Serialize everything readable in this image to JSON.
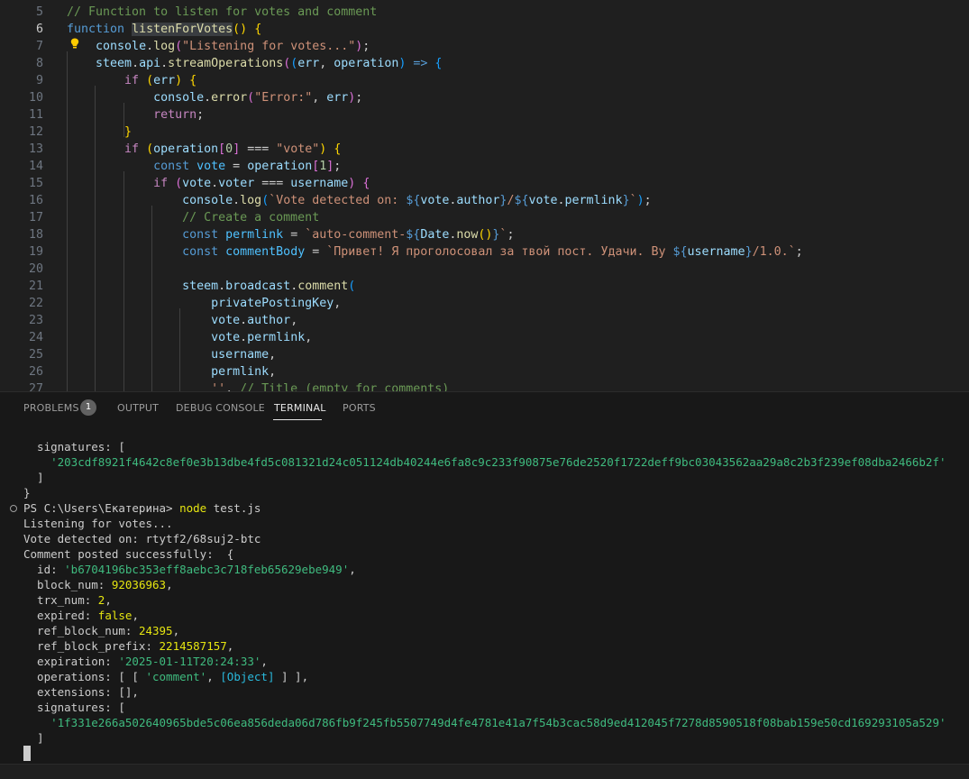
{
  "editor": {
    "lines": [
      {
        "n": "5",
        "tokens": [
          {
            "t": "// Function to listen for votes and comment",
            "c": "com"
          }
        ]
      },
      {
        "n": "6",
        "tokens": [
          {
            "t": "function ",
            "c": "kw"
          },
          {
            "t": "listenForVotes",
            "c": "fn",
            "hl": true
          },
          {
            "t": "(",
            "c": "p1"
          },
          {
            "t": ")",
            "c": "p1"
          },
          {
            "t": " ",
            "c": ""
          },
          {
            "t": "{",
            "c": "p1"
          }
        ]
      },
      {
        "n": "7",
        "tokens": [
          {
            "t": "    ",
            "c": ""
          },
          {
            "t": "console",
            "c": "var"
          },
          {
            "t": ".",
            "c": ""
          },
          {
            "t": "log",
            "c": "fn"
          },
          {
            "t": "(",
            "c": "p2"
          },
          {
            "t": "\"Listening for votes...\"",
            "c": "str"
          },
          {
            "t": ")",
            "c": "p2"
          },
          {
            "t": ";",
            "c": ""
          }
        ]
      },
      {
        "n": "8",
        "tokens": [
          {
            "t": "    ",
            "c": ""
          },
          {
            "t": "steem",
            "c": "var"
          },
          {
            "t": ".",
            "c": ""
          },
          {
            "t": "api",
            "c": "var"
          },
          {
            "t": ".",
            "c": ""
          },
          {
            "t": "streamOperations",
            "c": "fn"
          },
          {
            "t": "(",
            "c": "p2"
          },
          {
            "t": "(",
            "c": "p3"
          },
          {
            "t": "err",
            "c": "var"
          },
          {
            "t": ", ",
            "c": ""
          },
          {
            "t": "operation",
            "c": "var"
          },
          {
            "t": ")",
            "c": "p3"
          },
          {
            "t": " => ",
            "c": "kw"
          },
          {
            "t": "{",
            "c": "p3"
          }
        ]
      },
      {
        "n": "9",
        "tokens": [
          {
            "t": "        ",
            "c": ""
          },
          {
            "t": "if",
            "c": "ctl"
          },
          {
            "t": " ",
            "c": ""
          },
          {
            "t": "(",
            "c": "p1"
          },
          {
            "t": "err",
            "c": "var"
          },
          {
            "t": ")",
            "c": "p1"
          },
          {
            "t": " ",
            "c": ""
          },
          {
            "t": "{",
            "c": "p1"
          }
        ]
      },
      {
        "n": "10",
        "tokens": [
          {
            "t": "            ",
            "c": ""
          },
          {
            "t": "console",
            "c": "var"
          },
          {
            "t": ".",
            "c": ""
          },
          {
            "t": "error",
            "c": "fn"
          },
          {
            "t": "(",
            "c": "p2"
          },
          {
            "t": "\"Error:\"",
            "c": "str"
          },
          {
            "t": ", ",
            "c": ""
          },
          {
            "t": "err",
            "c": "var"
          },
          {
            "t": ")",
            "c": "p2"
          },
          {
            "t": ";",
            "c": ""
          }
        ]
      },
      {
        "n": "11",
        "tokens": [
          {
            "t": "            ",
            "c": ""
          },
          {
            "t": "return",
            "c": "ctl"
          },
          {
            "t": ";",
            "c": ""
          }
        ]
      },
      {
        "n": "12",
        "tokens": [
          {
            "t": "        ",
            "c": ""
          },
          {
            "t": "}",
            "c": "p1"
          }
        ]
      },
      {
        "n": "13",
        "tokens": [
          {
            "t": "        ",
            "c": ""
          },
          {
            "t": "if",
            "c": "ctl"
          },
          {
            "t": " ",
            "c": ""
          },
          {
            "t": "(",
            "c": "p1"
          },
          {
            "t": "operation",
            "c": "var"
          },
          {
            "t": "[",
            "c": "p2"
          },
          {
            "t": "0",
            "c": "num"
          },
          {
            "t": "]",
            "c": "p2"
          },
          {
            "t": " === ",
            "c": ""
          },
          {
            "t": "\"vote\"",
            "c": "str"
          },
          {
            "t": ")",
            "c": "p1"
          },
          {
            "t": " ",
            "c": ""
          },
          {
            "t": "{",
            "c": "p1"
          }
        ]
      },
      {
        "n": "14",
        "tokens": [
          {
            "t": "            ",
            "c": ""
          },
          {
            "t": "const ",
            "c": "kw"
          },
          {
            "t": "vote",
            "c": "const"
          },
          {
            "t": " = ",
            "c": ""
          },
          {
            "t": "operation",
            "c": "var"
          },
          {
            "t": "[",
            "c": "p2"
          },
          {
            "t": "1",
            "c": "num"
          },
          {
            "t": "]",
            "c": "p2"
          },
          {
            "t": ";",
            "c": ""
          }
        ]
      },
      {
        "n": "15",
        "tokens": [
          {
            "t": "            ",
            "c": ""
          },
          {
            "t": "if",
            "c": "ctl"
          },
          {
            "t": " ",
            "c": ""
          },
          {
            "t": "(",
            "c": "p2"
          },
          {
            "t": "vote",
            "c": "var"
          },
          {
            "t": ".",
            "c": ""
          },
          {
            "t": "voter",
            "c": "var"
          },
          {
            "t": " === ",
            "c": ""
          },
          {
            "t": "username",
            "c": "var"
          },
          {
            "t": ")",
            "c": "p2"
          },
          {
            "t": " ",
            "c": ""
          },
          {
            "t": "{",
            "c": "p2"
          }
        ]
      },
      {
        "n": "16",
        "tokens": [
          {
            "t": "                ",
            "c": ""
          },
          {
            "t": "console",
            "c": "var"
          },
          {
            "t": ".",
            "c": ""
          },
          {
            "t": "log",
            "c": "fn"
          },
          {
            "t": "(",
            "c": "p3"
          },
          {
            "t": "`Vote detected on: ",
            "c": "str"
          },
          {
            "t": "${",
            "c": "kw"
          },
          {
            "t": "vote",
            "c": "var"
          },
          {
            "t": ".",
            "c": ""
          },
          {
            "t": "author",
            "c": "var"
          },
          {
            "t": "}",
            "c": "kw"
          },
          {
            "t": "/",
            "c": "str"
          },
          {
            "t": "${",
            "c": "kw"
          },
          {
            "t": "vote",
            "c": "var"
          },
          {
            "t": ".",
            "c": ""
          },
          {
            "t": "permlink",
            "c": "var"
          },
          {
            "t": "}",
            "c": "kw"
          },
          {
            "t": "`",
            "c": "str"
          },
          {
            "t": ")",
            "c": "p3"
          },
          {
            "t": ";",
            "c": ""
          }
        ]
      },
      {
        "n": "17",
        "tokens": [
          {
            "t": "                ",
            "c": ""
          },
          {
            "t": "// Create a comment",
            "c": "com"
          }
        ]
      },
      {
        "n": "18",
        "tokens": [
          {
            "t": "                ",
            "c": ""
          },
          {
            "t": "const ",
            "c": "kw"
          },
          {
            "t": "permlink",
            "c": "const"
          },
          {
            "t": " = ",
            "c": ""
          },
          {
            "t": "`auto-comment-",
            "c": "str"
          },
          {
            "t": "${",
            "c": "kw"
          },
          {
            "t": "Date",
            "c": "var"
          },
          {
            "t": ".",
            "c": ""
          },
          {
            "t": "now",
            "c": "fn"
          },
          {
            "t": "()",
            "c": "p1"
          },
          {
            "t": "}",
            "c": "kw"
          },
          {
            "t": "`",
            "c": "str"
          },
          {
            "t": ";",
            "c": ""
          }
        ]
      },
      {
        "n": "19",
        "tokens": [
          {
            "t": "                ",
            "c": ""
          },
          {
            "t": "const ",
            "c": "kw"
          },
          {
            "t": "commentBody",
            "c": "const"
          },
          {
            "t": " = ",
            "c": ""
          },
          {
            "t": "`Привет! Я проголосовал за твой пост. Удачи. By ",
            "c": "str"
          },
          {
            "t": "${",
            "c": "kw"
          },
          {
            "t": "username",
            "c": "var"
          },
          {
            "t": "}",
            "c": "kw"
          },
          {
            "t": "/1.0.`",
            "c": "str"
          },
          {
            "t": ";",
            "c": ""
          }
        ]
      },
      {
        "n": "20",
        "tokens": []
      },
      {
        "n": "21",
        "tokens": [
          {
            "t": "                ",
            "c": ""
          },
          {
            "t": "steem",
            "c": "var"
          },
          {
            "t": ".",
            "c": ""
          },
          {
            "t": "broadcast",
            "c": "var"
          },
          {
            "t": ".",
            "c": ""
          },
          {
            "t": "comment",
            "c": "fn"
          },
          {
            "t": "(",
            "c": "p3"
          }
        ]
      },
      {
        "n": "22",
        "tokens": [
          {
            "t": "                    ",
            "c": ""
          },
          {
            "t": "privatePostingKey",
            "c": "var"
          },
          {
            "t": ",",
            "c": ""
          }
        ]
      },
      {
        "n": "23",
        "tokens": [
          {
            "t": "                    ",
            "c": ""
          },
          {
            "t": "vote",
            "c": "var"
          },
          {
            "t": ".",
            "c": ""
          },
          {
            "t": "author",
            "c": "var"
          },
          {
            "t": ",",
            "c": ""
          }
        ]
      },
      {
        "n": "24",
        "tokens": [
          {
            "t": "                    ",
            "c": ""
          },
          {
            "t": "vote",
            "c": "var"
          },
          {
            "t": ".",
            "c": ""
          },
          {
            "t": "permlink",
            "c": "var"
          },
          {
            "t": ",",
            "c": ""
          }
        ]
      },
      {
        "n": "25",
        "tokens": [
          {
            "t": "                    ",
            "c": ""
          },
          {
            "t": "username",
            "c": "var"
          },
          {
            "t": ",",
            "c": ""
          }
        ]
      },
      {
        "n": "26",
        "tokens": [
          {
            "t": "                    ",
            "c": ""
          },
          {
            "t": "permlink",
            "c": "var"
          },
          {
            "t": ",",
            "c": ""
          }
        ]
      },
      {
        "n": "27",
        "tokens": [
          {
            "t": "                    ",
            "c": ""
          },
          {
            "t": "''",
            "c": "str"
          },
          {
            "t": ", ",
            "c": ""
          },
          {
            "t": "// Title (empty for comments)",
            "c": "com"
          }
        ]
      }
    ],
    "active_line": "6"
  },
  "panel": {
    "tabs": [
      {
        "label": "PROBLEMS",
        "name": "tab-problems"
      },
      {
        "label": "OUTPUT",
        "name": "tab-output"
      },
      {
        "label": "DEBUG CONSOLE",
        "name": "tab-debug-console"
      },
      {
        "label": "TERMINAL",
        "name": "tab-terminal",
        "active": true
      },
      {
        "label": "PORTS",
        "name": "tab-ports"
      }
    ],
    "problems_count": "1"
  },
  "terminal": {
    "lines": [
      [
        {
          "t": "  signatures: [",
          "c": ""
        }
      ],
      [
        {
          "t": "    ",
          "c": ""
        },
        {
          "t": "'203cdf8921f4642c8ef0e3b13dbe4fd5c081321d24c051124db40244e6fa8c9c233f90875e76de2520f1722deff9bc03043562aa29a8c2b3f239ef08dba2466b2f'",
          "c": "green"
        }
      ],
      [
        {
          "t": "  ]",
          "c": ""
        }
      ],
      [
        {
          "t": "}",
          "c": ""
        }
      ],
      [
        {
          "t": "PS C:\\Users\\Екатерина> ",
          "c": ""
        },
        {
          "t": "node",
          "c": "yellow"
        },
        {
          "t": " test.js",
          "c": ""
        }
      ],
      [
        {
          "t": "Listening for votes...",
          "c": ""
        }
      ],
      [
        {
          "t": "Vote detected on: rtytf2/68suj2-btc",
          "c": ""
        }
      ],
      [
        {
          "t": "Comment posted successfully:  {",
          "c": ""
        }
      ],
      [
        {
          "t": "  id: ",
          "c": ""
        },
        {
          "t": "'b6704196bc353eff8aebc3c718feb65629ebe949'",
          "c": "green"
        },
        {
          "t": ",",
          "c": ""
        }
      ],
      [
        {
          "t": "  block_num: ",
          "c": ""
        },
        {
          "t": "92036963",
          "c": "yellow"
        },
        {
          "t": ",",
          "c": ""
        }
      ],
      [
        {
          "t": "  trx_num: ",
          "c": ""
        },
        {
          "t": "2",
          "c": "yellow"
        },
        {
          "t": ",",
          "c": ""
        }
      ],
      [
        {
          "t": "  expired: ",
          "c": ""
        },
        {
          "t": "false",
          "c": "yellow"
        },
        {
          "t": ",",
          "c": ""
        }
      ],
      [
        {
          "t": "  ref_block_num: ",
          "c": ""
        },
        {
          "t": "24395",
          "c": "yellow"
        },
        {
          "t": ",",
          "c": ""
        }
      ],
      [
        {
          "t": "  ref_block_prefix: ",
          "c": ""
        },
        {
          "t": "2214587157",
          "c": "yellow"
        },
        {
          "t": ",",
          "c": ""
        }
      ],
      [
        {
          "t": "  expiration: ",
          "c": ""
        },
        {
          "t": "'2025-01-11T20:24:33'",
          "c": "green"
        },
        {
          "t": ",",
          "c": ""
        }
      ],
      [
        {
          "t": "  operations: [ [ ",
          "c": ""
        },
        {
          "t": "'comment'",
          "c": "green"
        },
        {
          "t": ", ",
          "c": ""
        },
        {
          "t": "[Object]",
          "c": "cyan"
        },
        {
          "t": " ] ],",
          "c": ""
        }
      ],
      [
        {
          "t": "  extensions: [],",
          "c": ""
        }
      ],
      [
        {
          "t": "  signatures: [",
          "c": ""
        }
      ],
      [
        {
          "t": "    ",
          "c": ""
        },
        {
          "t": "'1f331e266a502640965bde5c06ea856deda06d786fb9f245fb5507749d4fe4781e41a7f54b3cac58d9ed412045f7278d8590518f08bab159e50cd169293105a529'",
          "c": "green"
        }
      ],
      [
        {
          "t": "  ]",
          "c": ""
        }
      ],
      [
        {
          "t": "}",
          "c": ""
        }
      ]
    ],
    "prompt_line_index": 4
  },
  "colors": {
    "editor_bg": "#1f1f1f",
    "panel_bg": "#181818",
    "string": "#ce9178",
    "keyword": "#569cd6",
    "terminal_green": "#3fbb7f",
    "terminal_yellow": "#e5e510"
  }
}
